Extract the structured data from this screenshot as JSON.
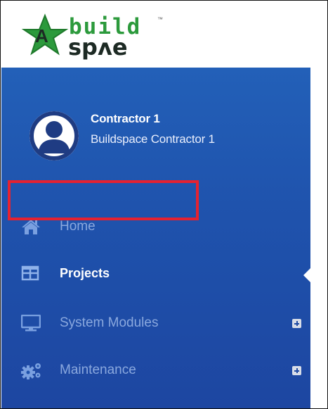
{
  "brand": {
    "line1": "build",
    "line2": "spʌe",
    "trademark": "™",
    "colors": {
      "green": "#2c9a3c",
      "dark": "#1d2a24"
    }
  },
  "user": {
    "name": "Contractor 1",
    "role": "Buildspace Contractor 1"
  },
  "nav": {
    "items": [
      {
        "label": "Home",
        "icon": "home-icon",
        "active": false,
        "expandable": false
      },
      {
        "label": "Projects",
        "icon": "table-icon",
        "active": true,
        "expandable": false
      },
      {
        "label": "System Modules",
        "icon": "monitor-icon",
        "active": false,
        "expandable": true
      },
      {
        "label": "Maintenance",
        "icon": "cogs-icon",
        "active": false,
        "expandable": true
      }
    ]
  },
  "colors": {
    "sidebar": "#2360b8",
    "inactive_text": "#8aa8de",
    "active_text": "#ffffff",
    "highlight": "#e52231"
  }
}
